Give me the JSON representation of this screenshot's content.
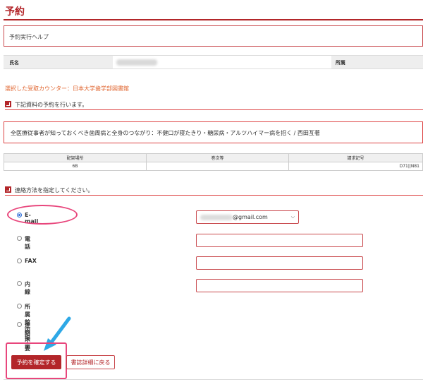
{
  "page": {
    "title": "予約"
  },
  "help": {
    "label": "予約実行ヘルプ"
  },
  "user": {
    "name_label": "氏名",
    "affiliation_label": "所属"
  },
  "counter": {
    "text": "選択した受取カウンター：日本大学歯学部図書館"
  },
  "reserve_section": {
    "heading": "下記資料の予約を行います。"
  },
  "item": {
    "title": "全医療従事者が知っておくべき歯周病と全身のつながり：不健口が寝たきり・糖尿病・アルツハイマー病を招く / 西田亙著"
  },
  "holdings_table": {
    "headers": [
      "配架場所",
      "巻次等",
      "請求記号"
    ],
    "rows": [
      [
        "6B",
        "",
        "D71||N81"
      ]
    ]
  },
  "contact_section": {
    "heading": "連絡方法を指定してください。"
  },
  "contact_options": [
    {
      "label": "E-mail",
      "selected": true
    },
    {
      "label": "電話",
      "selected": false
    },
    {
      "label": "FAX",
      "selected": false
    },
    {
      "label": "内線",
      "selected": false
    },
    {
      "label": "所属館内掲示",
      "selected": false
    },
    {
      "label": "連絡不要",
      "selected": false
    }
  ],
  "email_select": {
    "value": "@gmail.com"
  },
  "buttons": {
    "confirm": "予約を確定する",
    "back": "書誌詳細に戻る"
  },
  "colors": {
    "accent": "#b3262a",
    "counter_text": "#e0642e",
    "annotation": "#e8467c",
    "arrow": "#2ea8e6"
  }
}
